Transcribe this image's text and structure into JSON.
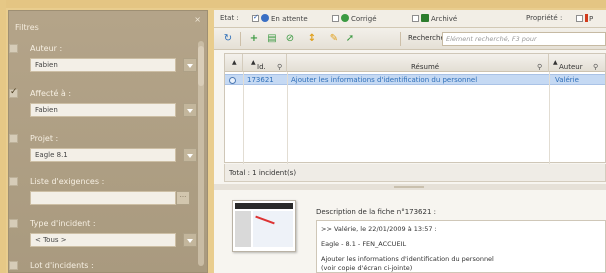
{
  "filters": {
    "title": "Filtres",
    "close_icon": "×",
    "items": [
      {
        "label": "Auteur :",
        "value": "Fabien",
        "checked": false,
        "control": "select"
      },
      {
        "label": "Affecté à :",
        "value": "Fabien",
        "checked": true,
        "control": "select"
      },
      {
        "label": "Projet :",
        "value": "Eagle 8.1",
        "checked": false,
        "control": "select"
      },
      {
        "label": "Liste d'exigences :",
        "value": "",
        "checked": false,
        "control": "browse"
      },
      {
        "label": "Type d'incident :",
        "value": "< Tous >",
        "checked": false,
        "control": "select"
      },
      {
        "label": "Lot d'incidents :",
        "value": "",
        "checked": false,
        "control": "none"
      }
    ]
  },
  "statusbar": {
    "etat_label": "Etat :",
    "en_attente": "En attente",
    "corrige": "Corrigé",
    "archive": "Archivé",
    "propriete_label": "Propriété :",
    "propriete_value": "P"
  },
  "toolbar": {
    "search_label": "Recherche :",
    "search_placeholder": "Elément recherché, F3 pour"
  },
  "grid": {
    "columns": [
      "Id.",
      "Résumé",
      "Auteur"
    ],
    "rows": [
      {
        "id": "173621",
        "summary": "Ajouter les informations d'identification du personnel",
        "author": "Valérie"
      }
    ]
  },
  "total_text": "Total : 1 incident(s)",
  "detail": {
    "title": "Description de la fiche n°173621 :",
    "lines": [
      ">> Valérie, le 22/01/2009 à 13:57 :",
      "Eagle - 8.1 - FEN_ACCUEIL",
      "Ajouter les informations d'identification du personnel",
      "(voir copie d'écran ci-jointe)"
    ]
  },
  "colors": {
    "frame": "#e9cd8e",
    "filter_panel": "#ad9e83",
    "selection": "#c5d9f3",
    "link": "#2f6fb9"
  }
}
